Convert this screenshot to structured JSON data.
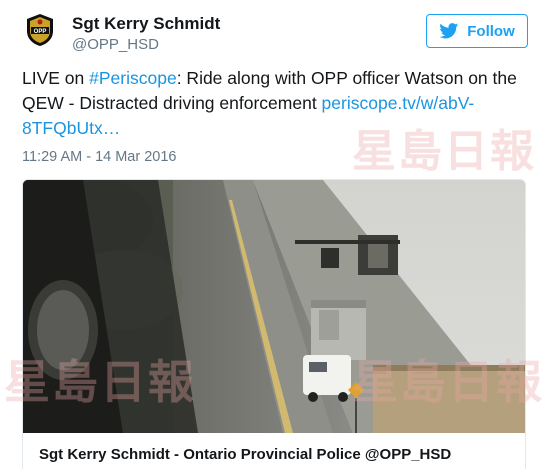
{
  "author": {
    "display_name": "Sgt Kerry Schmidt",
    "handle": "@OPP_HSD",
    "avatar_text": "OPP"
  },
  "follow_button": {
    "label": "Follow"
  },
  "tweet": {
    "text_prefix": "LIVE on ",
    "hashtag": "#Periscope",
    "text_body": ": Ride along with OPP officer Watson on the QEW - Distracted driving enforcement ",
    "link": "periscope.tv/w/abV-8TFQbUtx…"
  },
  "timestamp": "11:29 AM - 14 Mar 2016",
  "card": {
    "caption": "Sgt Kerry Schmidt - Ontario Provincial Police @OPP_HSD"
  },
  "watermark": {
    "text": "星島日報"
  },
  "colors": {
    "accent": "#1da1f2",
    "link": "#1b95e0",
    "muted": "#657786"
  }
}
